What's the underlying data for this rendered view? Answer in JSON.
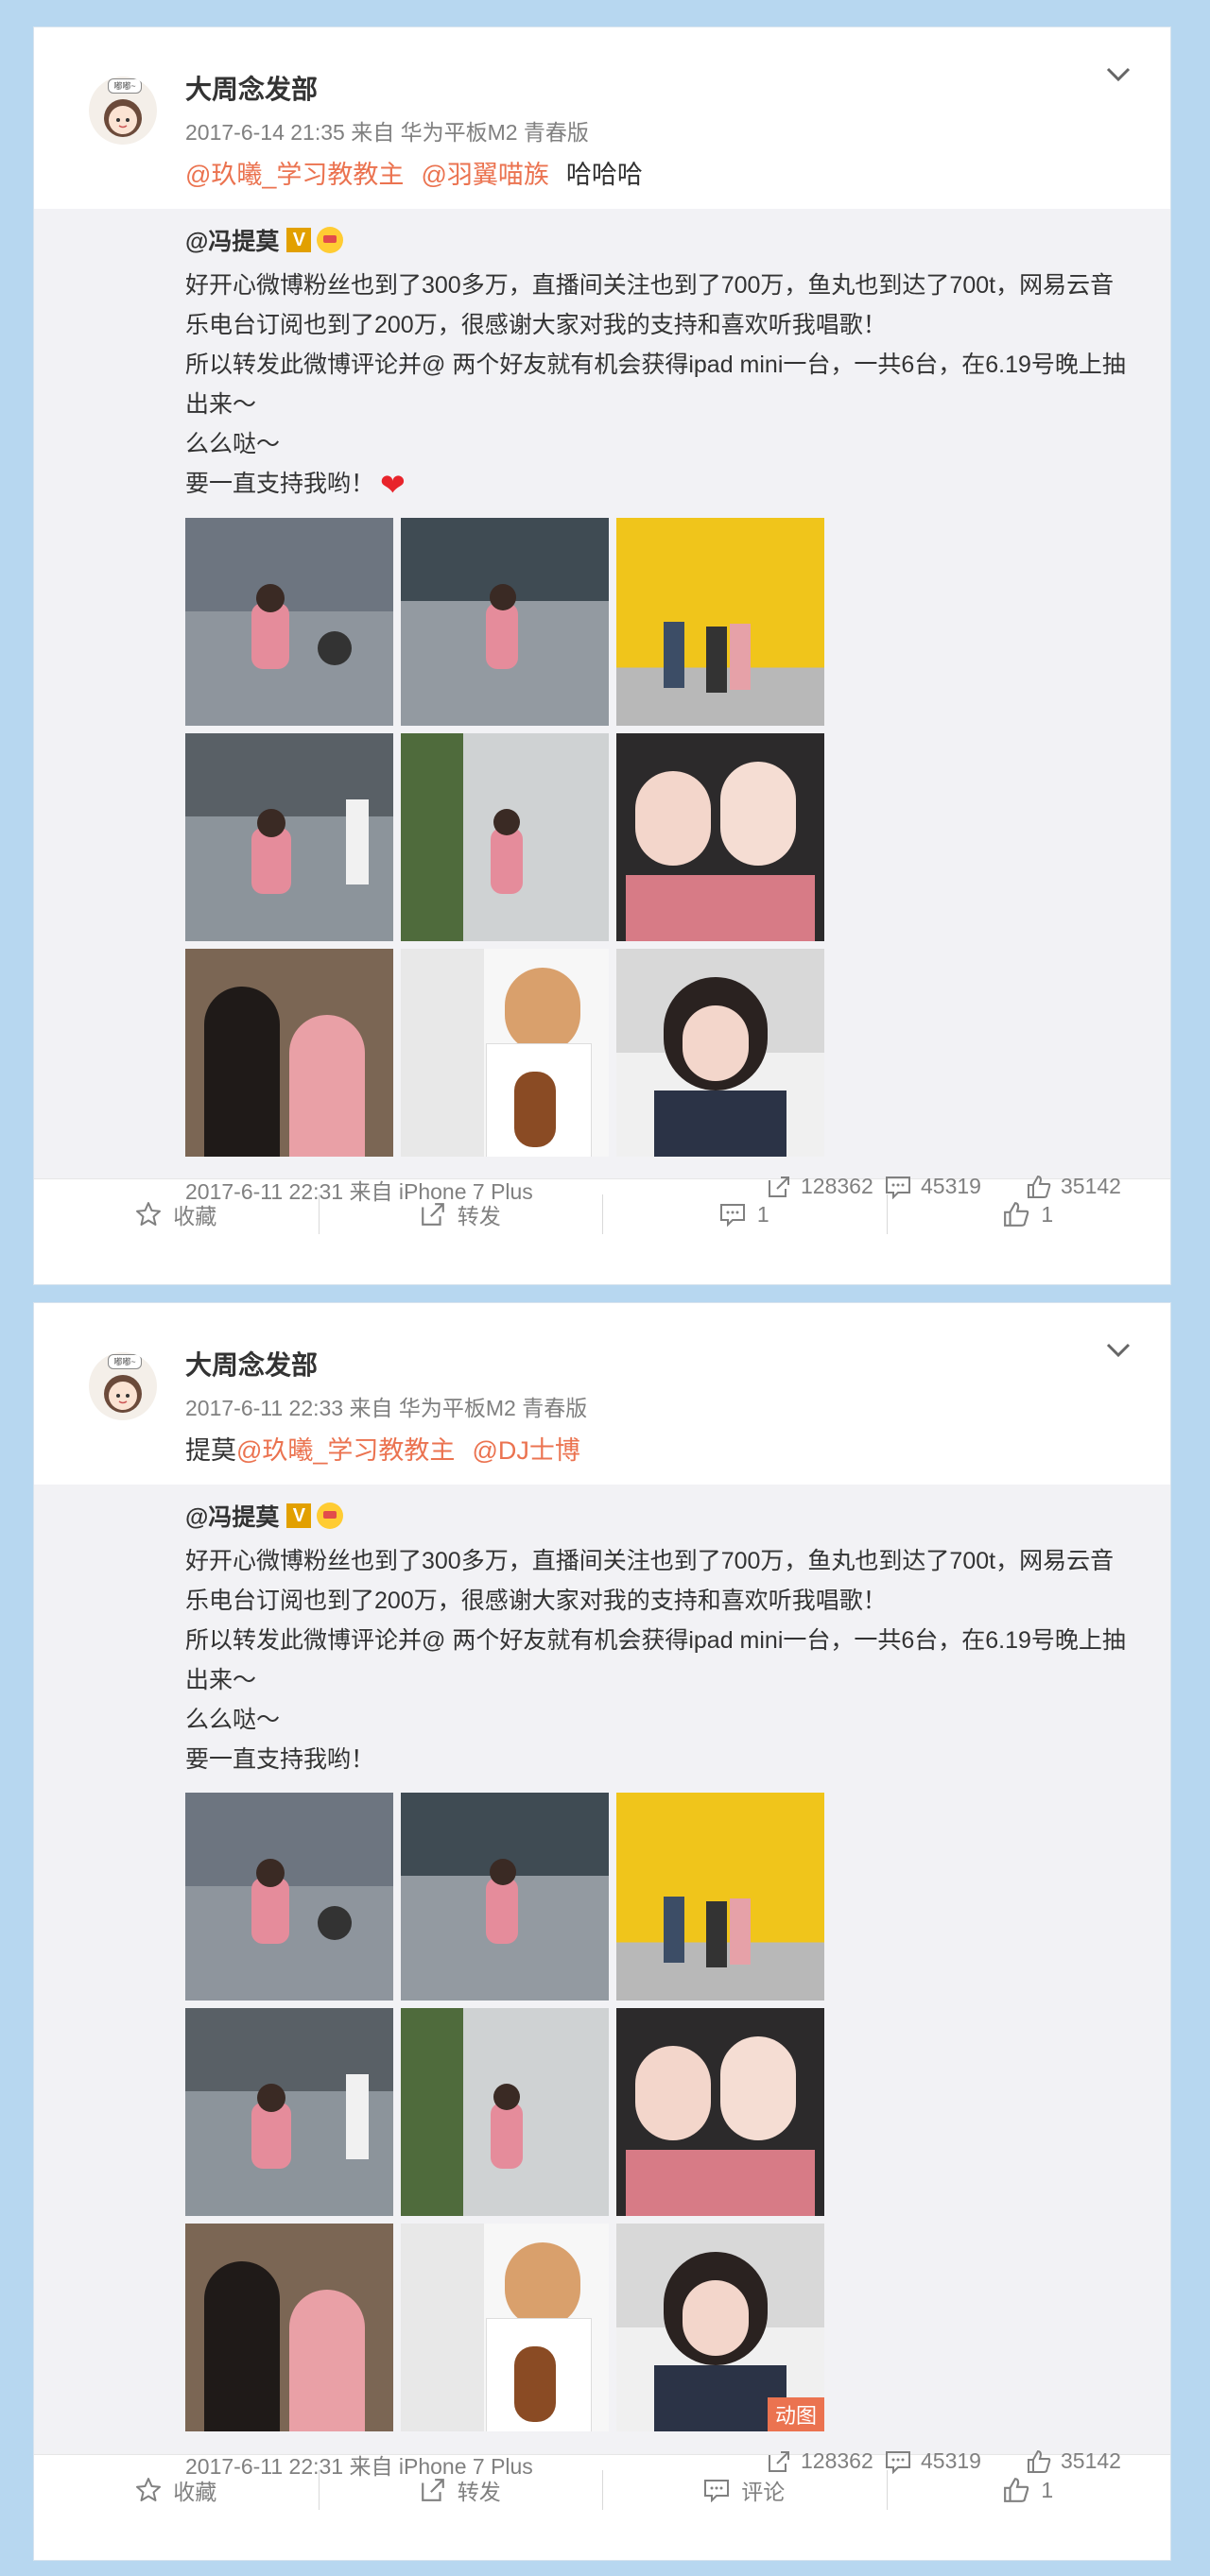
{
  "posts": [
    {
      "avatar_badge": "嘟嘟~",
      "user": "大周念发部",
      "meta": "2017-6-14 21:35 来自 华为平板M2 青春版",
      "text_prefix": "",
      "mentions": [
        "@玖曦_学习教教主",
        "@羽翼喵族"
      ],
      "text_suffix": "哈哈哈",
      "repost": {
        "user": "@冯提莫",
        "lines": [
          "好开心微博粉丝也到了300多万，直播间关注也到了700万，鱼丸也到达了700t，网易云音乐电台订阅也到了200万，很感谢大家对我的支持和喜欢听我唱歌！",
          "所以转发此微博评论并@ 两个好友就有机会获得ipad mini一台，一共6台，在6.19号晚上抽出来～",
          "么么哒～",
          "要一直支持我哟！"
        ],
        "has_heart": true,
        "gif_label": "",
        "source": "2017-6-11 22:31 来自 iPhone 7 Plus",
        "reposts": "128362",
        "comments": "45319",
        "likes": "35142"
      },
      "actions": {
        "favorite": "收藏",
        "repost": "转发",
        "comment": "1",
        "like": "1"
      }
    },
    {
      "avatar_badge": "嘟嘟~",
      "user": "大周念发部",
      "meta": "2017-6-11 22:33 来自 华为平板M2 青春版",
      "text_prefix": "提莫",
      "mentions": [
        "@玖曦_学习教教主",
        "@DJ士博"
      ],
      "text_suffix": "",
      "repost": {
        "user": "@冯提莫",
        "lines": [
          "好开心微博粉丝也到了300多万，直播间关注也到了700万，鱼丸也到达了700t，网易云音乐电台订阅也到了200万，很感谢大家对我的支持和喜欢听我唱歌！",
          "所以转发此微博评论并@ 两个好友就有机会获得ipad mini一台，一共6台，在6.19号晚上抽出来～",
          "么么哒～",
          "要一直支持我哟！"
        ],
        "has_heart": false,
        "gif_label": "动图",
        "source": "2017-6-11 22:31 来自 iPhone 7 Plus",
        "reposts": "128362",
        "comments": "45319",
        "likes": "35142"
      },
      "actions": {
        "favorite": "收藏",
        "repost": "转发",
        "comment": "评论",
        "like": "1"
      }
    }
  ],
  "colors": {
    "page_bg": "#b7d7f0",
    "mention": "#eb7350",
    "repost_bg": "#f2f2f5"
  },
  "icons": {
    "favorite": "star-icon",
    "repost": "share-out-icon",
    "comment": "comment-icon",
    "like": "thumb-up-icon",
    "menu": "chevron-down-icon"
  }
}
